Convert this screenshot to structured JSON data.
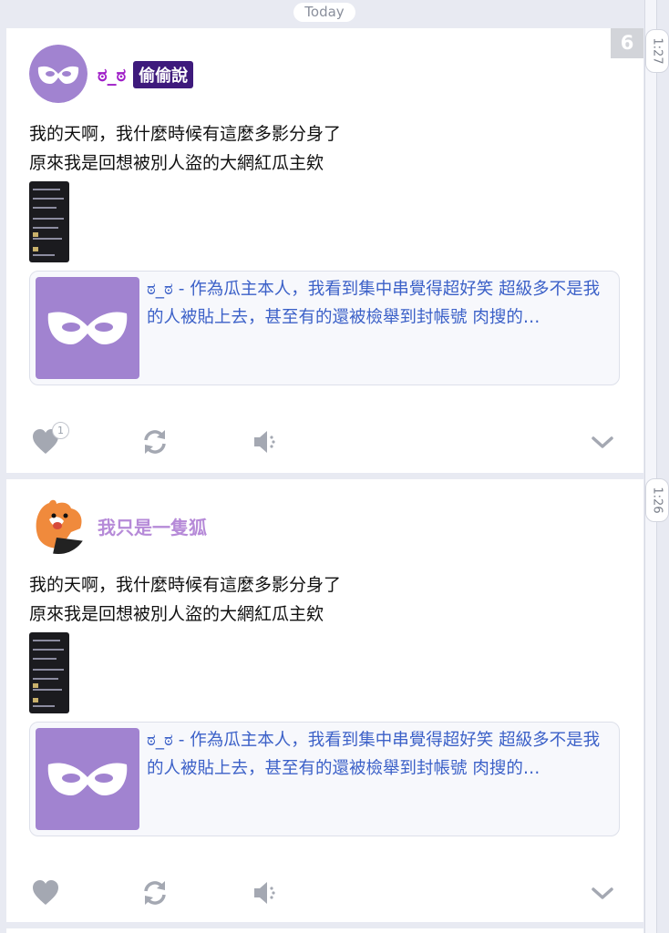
{
  "header": {
    "date_divider": "Today"
  },
  "timeline": {
    "times": [
      "1:27",
      "1:26"
    ]
  },
  "posts": [
    {
      "unread_count": "6",
      "author": {
        "name": "ಠ_ಠ",
        "name_color": "#a020c8",
        "badge": "偷偷說",
        "avatar": "mask-avatar"
      },
      "lines": [
        "我的天啊，我什麼時候有這麼多影分身了",
        "原來我是回想被別人盜的大網紅瓜主欸"
      ],
      "link": {
        "text": "ಠ_ಠ - 作為瓜主本人，我看到集中串覺得超好笑 超級多不是我的人被貼上去，甚至有的還被檢舉到封帳號 肉搜的…"
      },
      "likes": "1",
      "icons": [
        "heart-icon",
        "repost-icon",
        "mute-icon",
        "chevron-down-icon"
      ]
    },
    {
      "author": {
        "name": "我只是一隻狐",
        "name_color": "#b68ad8",
        "avatar": "fox-avatar"
      },
      "lines": [
        "我的天啊，我什麼時候有這麼多影分身了",
        "原來我是回想被別人盜的大網紅瓜主欸"
      ],
      "link": {
        "text": "ಠ_ಠ - 作為瓜主本人，我看到集中串覺得超好笑 超級多不是我的人被貼上去，甚至有的還被檢舉到封帳號 肉搜的…"
      },
      "icons": [
        "heart-icon",
        "repost-icon",
        "mute-icon",
        "chevron-down-icon"
      ]
    }
  ],
  "colors": {
    "badge_bg": "#3e1a7c",
    "link_text": "#3c61c8",
    "avatar_bg": "#a183d0",
    "icon_gray": "#a4a8b2"
  }
}
